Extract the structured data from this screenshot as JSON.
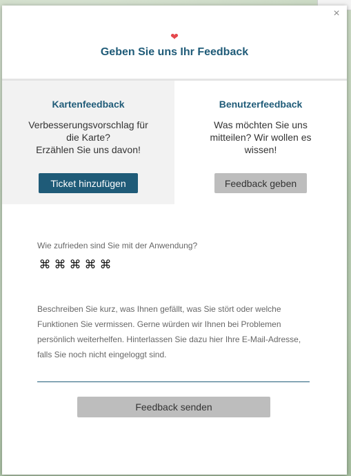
{
  "close": {
    "glyph": "×",
    "icon": "close-icon"
  },
  "header": {
    "heart_glyph": "❤",
    "heart_color": "#e5484d",
    "title": "Geben Sie uns Ihr Feedback"
  },
  "map_feedback": {
    "title": "Kartenfeedback",
    "text_lines": [
      "Verbesserungsvorschlag für",
      "die Karte?",
      "Erzählen Sie uns davon!"
    ],
    "button_label": "Ticket hinzufügen"
  },
  "user_feedback": {
    "title": "Benutzerfeedback",
    "text_lines": [
      "Was möchten Sie uns",
      "mitteilen? Wir wollen es",
      "wissen!"
    ],
    "button_label": "Feedback geben"
  },
  "rating": {
    "question": "Wie zufrieden sind Sie mit der Anwendung?",
    "icon": "drone-icon",
    "glyphs": [
      "⌘",
      "⌘",
      "⌘",
      "⌘",
      "⌘"
    ],
    "selected": 0
  },
  "description": "Beschreiben Sie kurz, was Ihnen gefällt, was Sie stört oder welche Funktionen Sie vermissen. Gerne würden wir Ihnen bei Problemen persönlich weiterhelfen. Hinterlassen Sie dazu hier Ihre E-Mail-Adresse, falls Sie noch nicht eingeloggt sind.",
  "input": {
    "value": "",
    "placeholder": ""
  },
  "send_button_label": "Feedback senden",
  "colors": {
    "accent": "#1f5b78",
    "button_disabled": "#bdbdbd",
    "card_bg": "#f2f2f2"
  }
}
